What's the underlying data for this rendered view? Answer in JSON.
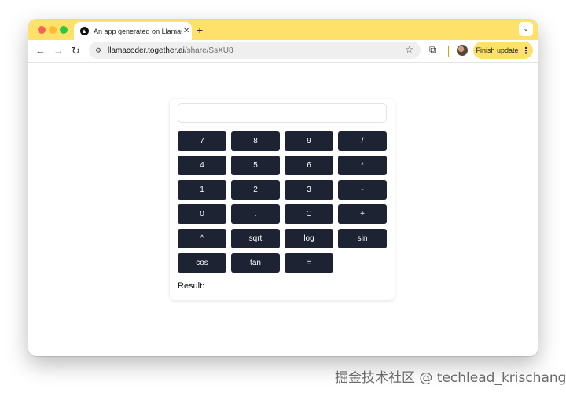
{
  "browser": {
    "tab": {
      "title": "An app generated on LlamaCoder",
      "close": "✕"
    },
    "new_tab": "+",
    "tab_search": "⌄",
    "nav": {
      "back": "←",
      "forward": "→",
      "reload": "↻"
    },
    "site_info": "⚙",
    "url": {
      "host": "llamacoder.together.ai",
      "path": "/share/SsXU8"
    },
    "bookmark": "☆",
    "extensions": "⧉",
    "update_button": {
      "label": "Finish update",
      "menu": "⋮"
    }
  },
  "calculator": {
    "input": {
      "value": "",
      "placeholder": ""
    },
    "keys": [
      "7",
      "8",
      "9",
      "/",
      "4",
      "5",
      "6",
      "*",
      "1",
      "2",
      "3",
      "-",
      "0",
      ".",
      "C",
      "+",
      "^",
      "sqrt",
      "log",
      "sin",
      "cos",
      "tan",
      "="
    ],
    "result_label": "Result:"
  },
  "watermark": "掘金技术社区 @ techlead_krischang",
  "colors": {
    "chrome_yellow": "#fde16a",
    "key_bg": "#1d2333",
    "key_text": "#ffffff"
  }
}
